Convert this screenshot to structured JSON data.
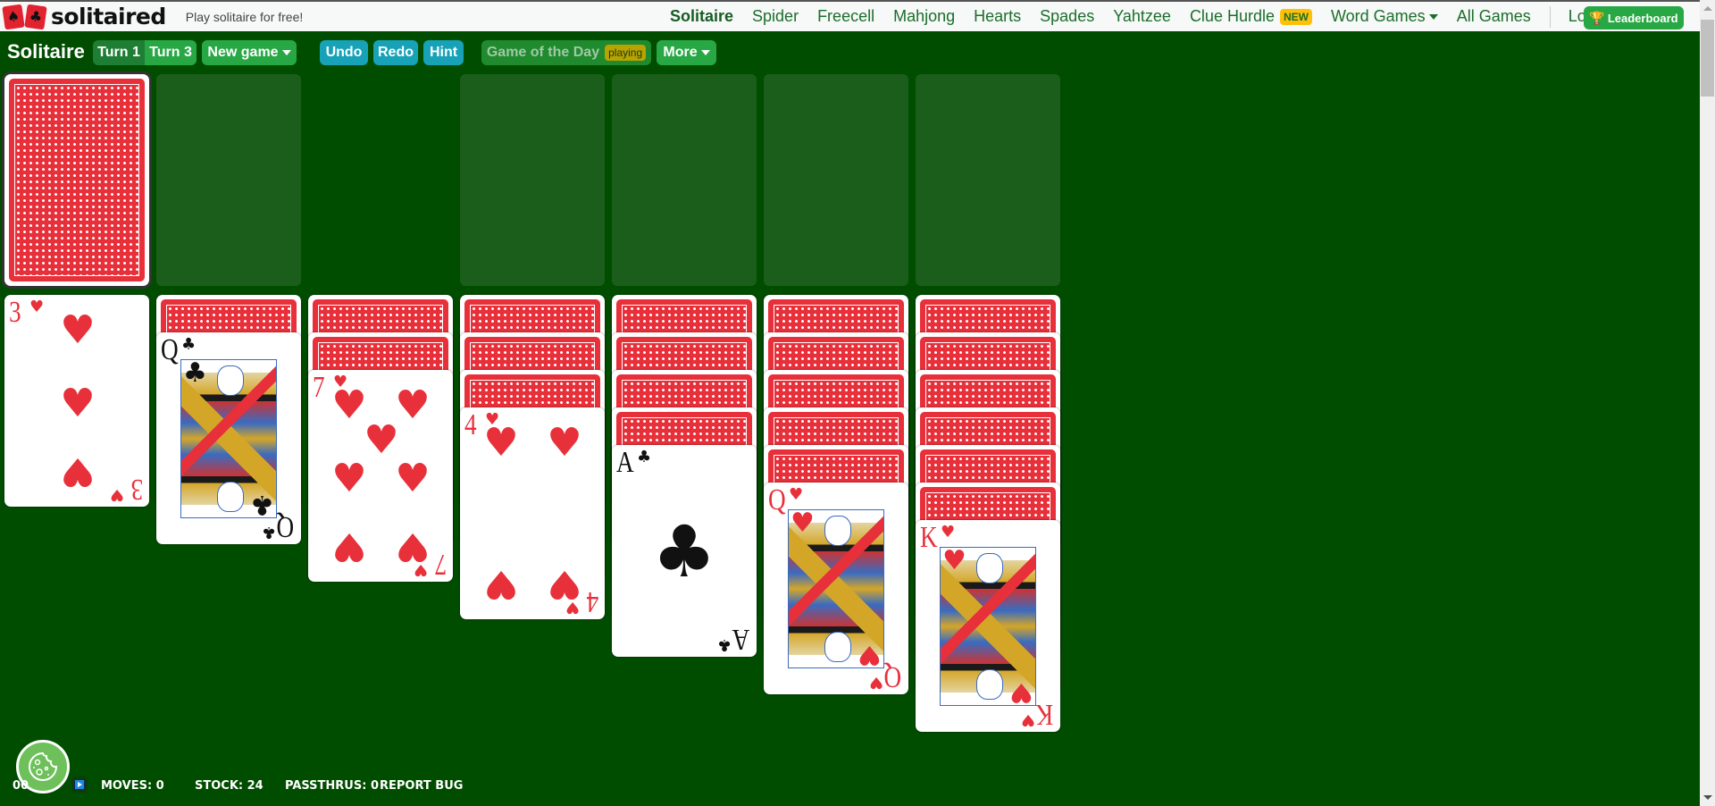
{
  "topnav": {
    "logo_text": "solitaired",
    "tagline": "Play solitaire for free!",
    "links": [
      {
        "label": "Solitaire",
        "active": true
      },
      {
        "label": "Spider"
      },
      {
        "label": "Freecell"
      },
      {
        "label": "Mahjong"
      },
      {
        "label": "Hearts"
      },
      {
        "label": "Spades"
      },
      {
        "label": "Yahtzee"
      },
      {
        "label": "Clue Hurdle",
        "badge": "NEW"
      },
      {
        "label": "Word Games",
        "dropdown": true
      },
      {
        "label": "All Games"
      }
    ],
    "login": "Login",
    "leaderboard": "Leaderboard"
  },
  "toolbar": {
    "title": "Solitaire",
    "turn1": "Turn 1",
    "turn3": "Turn 3",
    "turn_selected": "Turn 1",
    "new_game": "New game",
    "undo": "Undo",
    "redo": "Redo",
    "hint": "Hint",
    "game_of_the_day": "Game of the Day",
    "gotd_badge": "playing",
    "more": "More"
  },
  "board": {
    "stock": {
      "count": 24,
      "face": "down"
    },
    "waste": [],
    "foundations": [
      [],
      [],
      [],
      []
    ],
    "tableau": [
      {
        "facedown": 0,
        "faceup": [
          {
            "rank": "3",
            "suit": "hearts"
          }
        ]
      },
      {
        "facedown": 1,
        "faceup": [
          {
            "rank": "Q",
            "suit": "clubs"
          }
        ]
      },
      {
        "facedown": 2,
        "faceup": [
          {
            "rank": "7",
            "suit": "hearts"
          }
        ]
      },
      {
        "facedown": 3,
        "faceup": [
          {
            "rank": "4",
            "suit": "hearts"
          }
        ]
      },
      {
        "facedown": 4,
        "faceup": [
          {
            "rank": "A",
            "suit": "clubs"
          }
        ]
      },
      {
        "facedown": 5,
        "faceup": [
          {
            "rank": "Q",
            "suit": "hearts"
          }
        ]
      },
      {
        "facedown": 6,
        "faceup": [
          {
            "rank": "K",
            "suit": "hearts"
          }
        ]
      }
    ]
  },
  "status": {
    "timer": "00",
    "moves": "MOVES: 0",
    "stock": "STOCK: 24",
    "passthrus": "PASSTHRUS: 0",
    "report_bug": "REPORT BUG"
  },
  "colors": {
    "felt": "#004d00",
    "slot": "#1b5e1b",
    "card_back": "#e8303a",
    "red_suit": "#e8303a",
    "button_green": "#28a745",
    "button_teal": "#17a2b8",
    "nav_link": "#1b6e2a"
  }
}
